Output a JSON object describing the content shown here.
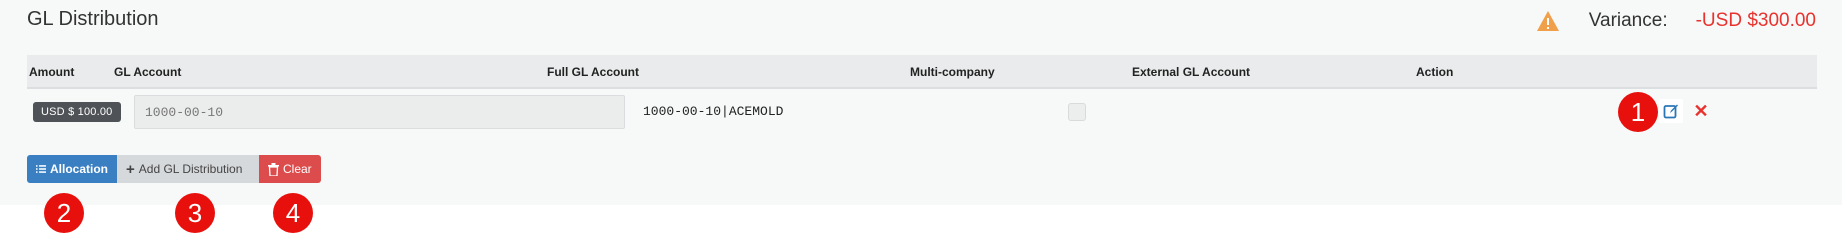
{
  "header": {
    "title": "GL Distribution",
    "variance_label": "Variance:",
    "variance_value": "-USD $300.00",
    "warning_color": "#f0a04b",
    "variance_color": "#e8322e"
  },
  "table": {
    "columns": [
      "Amount",
      "GL Account",
      "Full GL Account",
      "Multi-company",
      "External GL Account",
      "Action"
    ],
    "rows": [
      {
        "amount": "USD $ 100.00",
        "gl_account": "1000-00-10",
        "full_gl_account": "1000-00-10|ACEMOLD",
        "multi_company": false,
        "external_gl_account": ""
      }
    ]
  },
  "buttons": {
    "allocation": "Allocation",
    "add_gl": "Add GL Distribution",
    "clear": "Clear"
  },
  "markers": [
    "1",
    "2",
    "3",
    "4"
  ]
}
